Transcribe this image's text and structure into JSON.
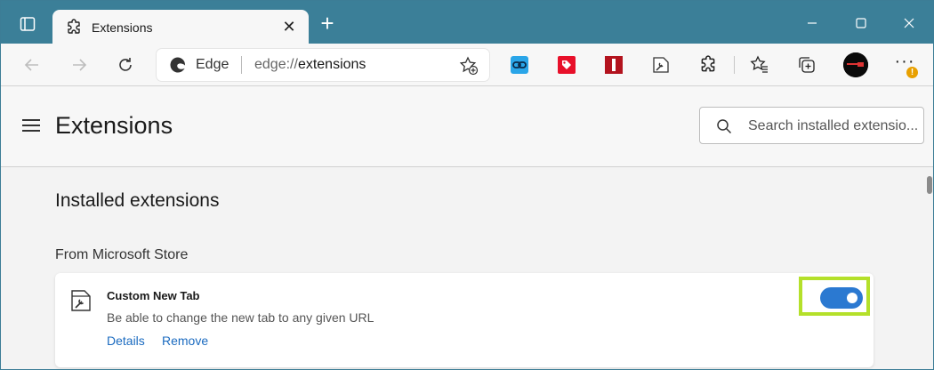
{
  "browser": {
    "tab": {
      "title": "Extensions",
      "close_glyph": "✕"
    },
    "new_tab_glyph": "+",
    "window_controls": [
      "minimize",
      "maximize",
      "close"
    ]
  },
  "toolbar": {
    "omnibox": {
      "site_label": "Edge",
      "url_protocol": "edge://",
      "url_path": "extensions"
    },
    "extension_icons": [
      "link-extension-icon",
      "tag-extension-icon",
      "red-bar-extension-icon",
      "custom-new-tab-extension-icon",
      "extensions-puzzle-icon"
    ],
    "more_glyph": "···",
    "warning_glyph": "!"
  },
  "header": {
    "title": "Extensions",
    "search_placeholder": "Search installed extensio..."
  },
  "main": {
    "section_title": "Installed extensions",
    "source_label": "From Microsoft Store",
    "extensions": [
      {
        "name": "Custom New Tab",
        "description": "Be able to change the new tab to any given URL",
        "details_label": "Details",
        "remove_label": "Remove",
        "enabled": true
      }
    ]
  },
  "colors": {
    "titlebar": "#3b7f98",
    "accent": "#2b79d1",
    "link": "#1b6bc0",
    "highlight": "#b4e02a"
  }
}
